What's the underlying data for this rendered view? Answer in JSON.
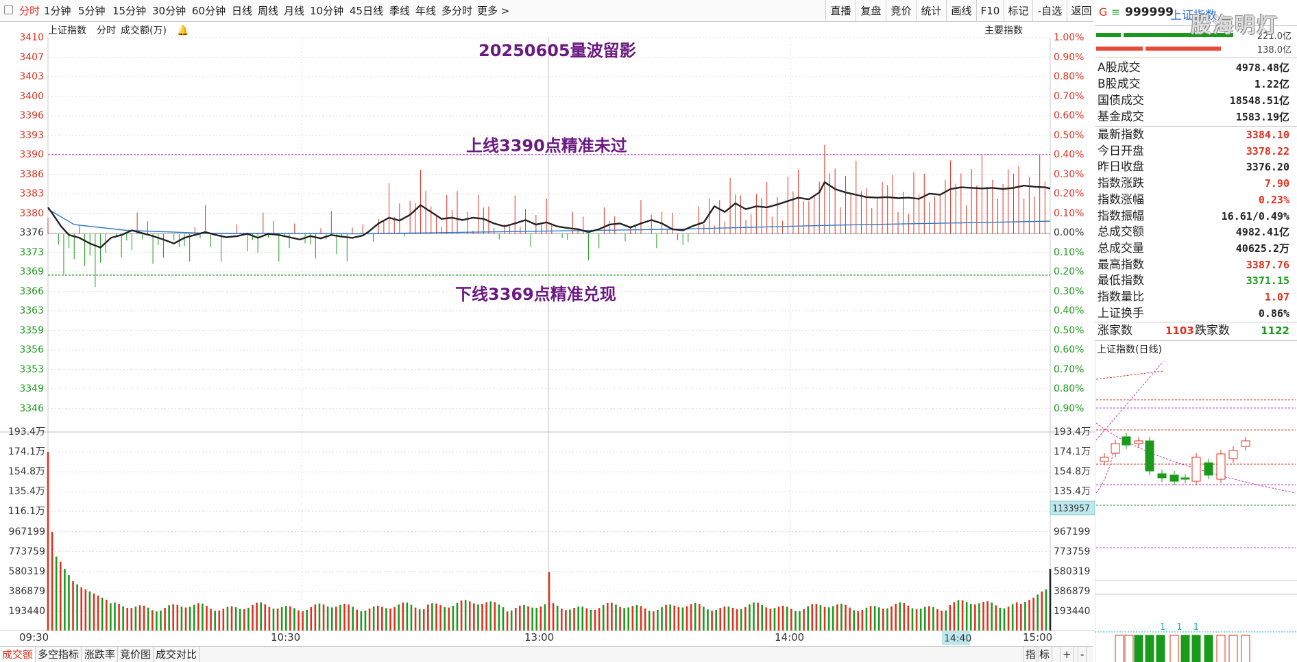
{
  "toolbar": {
    "periods": [
      {
        "label": "分时",
        "active": true
      },
      {
        "label": "1分钟"
      },
      {
        "label": "5分钟"
      },
      {
        "label": "15分钟"
      },
      {
        "label": "30分钟"
      },
      {
        "label": "60分钟"
      },
      {
        "label": "日线"
      },
      {
        "label": "周线"
      },
      {
        "label": "月线"
      },
      {
        "label": "10分钟"
      },
      {
        "label": "45日线"
      },
      {
        "label": "季线"
      },
      {
        "label": "年线"
      },
      {
        "label": "多分时"
      },
      {
        "label": "更多 >"
      }
    ],
    "right_buttons": [
      "直播",
      "复盘",
      "竞价",
      "统计",
      "画线",
      "F10",
      "标记",
      "-自选",
      "返回"
    ]
  },
  "chart_header": {
    "name": "上证指数",
    "mode": "分时",
    "indicator": "成交额(万)",
    "right_label": "主要指数"
  },
  "annotations": {
    "title": "20250605量波留影",
    "upper": "上线3390点精准未过",
    "lower": "下线3369点精准兑现"
  },
  "chart_data": {
    "type": "line",
    "prev_close": 3376.2,
    "upper_line": 3390,
    "lower_line": 3369,
    "price_ticks": [
      "3410",
      "3407",
      "3403",
      "3400",
      "3396",
      "3393",
      "3390",
      "3386",
      "3383",
      "3380",
      "3376",
      "3373",
      "3369",
      "3366",
      "3363",
      "3359",
      "3356",
      "3353",
      "3349",
      "3346"
    ],
    "pct_ticks": [
      "1.00%",
      "0.90%",
      "0.80%",
      "0.70%",
      "0.60%",
      "0.50%",
      "0.40%",
      "0.30%",
      "0.20%",
      "0.10%",
      "0.00%",
      "0.10%",
      "0.20%",
      "0.30%",
      "0.40%",
      "0.50%",
      "0.60%",
      "0.70%",
      "0.80%",
      "0.90%"
    ],
    "volume_ticks": [
      "193.4万",
      "174.1万",
      "154.8万",
      "135.4万",
      "116.1万",
      "967199",
      "773759",
      "580319",
      "386879",
      "193440"
    ],
    "current_volume_label": "1133957",
    "x_labels": [
      "09:30",
      "10:30",
      "13:00",
      "14:00",
      "15:00"
    ],
    "cursor_time": "14:40",
    "price_series": [
      [
        0,
        3380.8
      ],
      [
        2,
        3379.5
      ],
      [
        5,
        3377.5
      ],
      [
        8,
        3376
      ],
      [
        12,
        3375.5
      ],
      [
        16,
        3374.5
      ],
      [
        20,
        3373.8
      ],
      [
        24,
        3375.5
      ],
      [
        28,
        3376
      ],
      [
        32,
        3376.8
      ],
      [
        36,
        3376.3
      ],
      [
        40,
        3375.8
      ],
      [
        44,
        3375.2
      ],
      [
        48,
        3374.5
      ],
      [
        52,
        3375.5
      ],
      [
        56,
        3376
      ],
      [
        60,
        3376.5
      ],
      [
        64,
        3376
      ],
      [
        68,
        3375.6
      ],
      [
        72,
        3375.8
      ],
      [
        76,
        3376.2
      ],
      [
        80,
        3375.5
      ],
      [
        84,
        3376.2
      ],
      [
        88,
        3376
      ],
      [
        92,
        3375.6
      ],
      [
        96,
        3375.2
      ],
      [
        100,
        3375.8
      ],
      [
        104,
        3375.4
      ],
      [
        108,
        3376
      ],
      [
        112,
        3375.7
      ],
      [
        116,
        3375.5
      ],
      [
        120,
        3375.9
      ],
      [
        122,
        3376.5
      ],
      [
        126,
        3378
      ],
      [
        130,
        3379
      ],
      [
        134,
        3378.5
      ],
      [
        138,
        3379.5
      ],
      [
        142,
        3381.2
      ],
      [
        146,
        3380
      ],
      [
        150,
        3378.8
      ],
      [
        154,
        3379
      ],
      [
        158,
        3378.6
      ],
      [
        162,
        3379
      ],
      [
        166,
        3378.8
      ],
      [
        170,
        3378
      ],
      [
        174,
        3377.5
      ],
      [
        178,
        3378
      ],
      [
        182,
        3378.6
      ],
      [
        186,
        3377.8
      ],
      [
        190,
        3378.2
      ],
      [
        194,
        3377.5
      ],
      [
        198,
        3377.2
      ],
      [
        202,
        3377
      ],
      [
        206,
        3376.5
      ],
      [
        210,
        3377
      ],
      [
        214,
        3377.8
      ],
      [
        218,
        3378
      ],
      [
        222,
        3377.3
      ],
      [
        226,
        3378
      ],
      [
        230,
        3378.6
      ],
      [
        234,
        3378
      ],
      [
        238,
        3377
      ],
      [
        242,
        3376.8
      ],
      [
        246,
        3377.6
      ],
      [
        250,
        3378.2
      ],
      [
        254,
        3381
      ],
      [
        258,
        3380
      ],
      [
        262,
        3381.5
      ],
      [
        266,
        3380.5
      ],
      [
        270,
        3381
      ],
      [
        274,
        3380.8
      ],
      [
        278,
        3381.3
      ],
      [
        282,
        3381.9
      ],
      [
        286,
        3382.5
      ],
      [
        290,
        3382.2
      ],
      [
        294,
        3383.4
      ],
      [
        296,
        3385.2
      ],
      [
        300,
        3384
      ],
      [
        304,
        3383.4
      ],
      [
        308,
        3383
      ],
      [
        312,
        3382.6
      ],
      [
        316,
        3382.5
      ],
      [
        320,
        3382.6
      ],
      [
        324,
        3382.4
      ],
      [
        328,
        3382.5
      ],
      [
        332,
        3382.3
      ],
      [
        336,
        3383.2
      ],
      [
        340,
        3383
      ],
      [
        344,
        3384
      ],
      [
        348,
        3384.3
      ],
      [
        352,
        3384.2
      ],
      [
        356,
        3384.1
      ],
      [
        360,
        3384.2
      ],
      [
        364,
        3384
      ],
      [
        368,
        3384.2
      ],
      [
        372,
        3384.6
      ],
      [
        376,
        3384.4
      ],
      [
        380,
        3384.3
      ],
      [
        382,
        3384.1
      ]
    ],
    "avg_series": [
      [
        0,
        3380.5
      ],
      [
        10,
        3377.8
      ],
      [
        30,
        3376.8
      ],
      [
        60,
        3376.3
      ],
      [
        120,
        3376.2
      ],
      [
        180,
        3376.6
      ],
      [
        240,
        3377
      ],
      [
        300,
        3377.7
      ],
      [
        360,
        3378.2
      ],
      [
        382,
        3378.4
      ]
    ],
    "volume": {
      "bars_count": 241,
      "first_bar": 1740000,
      "open_phase": [
        960000,
        720000,
        670000,
        600000,
        540000,
        480000,
        450000,
        420000,
        400000,
        380000,
        360000,
        340000,
        320000,
        300000
      ],
      "base": 230000,
      "noon_spike": 570000,
      "close_ramp": [
        260000,
        280000,
        300000,
        320000,
        350000,
        380000,
        400000
      ],
      "last_bar": 600000
    }
  },
  "right_panel": {
    "code_prefix": "G",
    "code": "999999",
    "name": "上证指数",
    "bar_labels": [
      "221.0亿",
      "138.0亿"
    ],
    "turnover": [
      {
        "label": "A股成交",
        "value": "4978.48亿"
      },
      {
        "label": "B股成交",
        "value": "1.22亿"
      },
      {
        "label": "国债成交",
        "value": "18548.51亿"
      },
      {
        "label": "基金成交",
        "value": "1583.19亿"
      }
    ],
    "stats": [
      {
        "label": "最新指数",
        "value": "3384.10",
        "color": "#e0301e"
      },
      {
        "label": "今日开盘",
        "value": "3378.22",
        "color": "#e0301e"
      },
      {
        "label": "昨日收盘",
        "value": "3376.20",
        "color": "#222222"
      },
      {
        "label": "指数涨跌",
        "value": "7.90",
        "color": "#e0301e"
      },
      {
        "label": "指数涨幅",
        "value": "0.23%",
        "color": "#e0301e"
      },
      {
        "label": "指数振幅",
        "value": "16.61/0.49%",
        "color": "#222222"
      },
      {
        "label": "总成交额",
        "value": "4982.41亿",
        "color": "#222222"
      },
      {
        "label": "总成交量",
        "value": "40625.2万",
        "color": "#222222"
      },
      {
        "label": "最高指数",
        "value": "3387.76",
        "color": "#e0301e"
      },
      {
        "label": "最低指数",
        "value": "3371.15",
        "color": "#1a9a1a"
      },
      {
        "label": "指数量比",
        "value": "1.07",
        "color": "#e0301e"
      },
      {
        "label": "上证换手",
        "value": "0.86%",
        "color": "#222222"
      }
    ],
    "breadth": {
      "up_label": "涨家数",
      "up_value": "1103",
      "down_label": "跌家数",
      "down_value": "1122"
    },
    "mini_chart_title": "上证指数(日线)",
    "mini_marks": "1 1 1"
  },
  "bottom_tabs": [
    "成交额",
    "多空指标",
    "涨跌率",
    "竞价图",
    "成交对比"
  ],
  "bottom_right": [
    "指",
    "标",
    "+",
    "-"
  ],
  "watermark": "股海明灯",
  "colors": {
    "up": "#e0301e",
    "down": "#1a9a1a",
    "price_line": "#222222",
    "avg_line": "#2a78c8",
    "annotation": "#6b1a82"
  }
}
